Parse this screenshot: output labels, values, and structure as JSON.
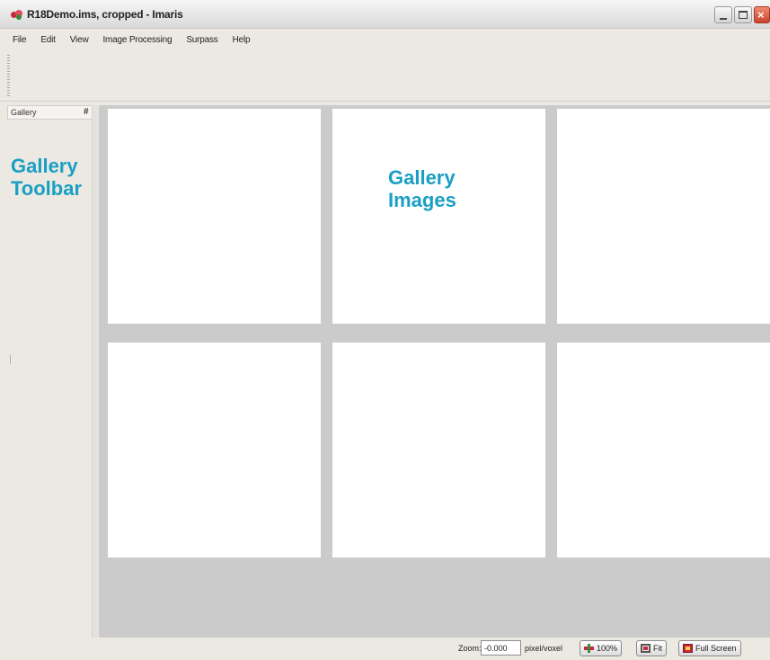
{
  "window": {
    "title": "R18Demo.ims, cropped  - Imaris",
    "controls": {
      "minimize": "_",
      "maximize": "□",
      "close": "×"
    }
  },
  "menu": {
    "items": [
      "File",
      "Edit",
      "View",
      "Image Processing",
      "Surpass",
      "Help"
    ]
  },
  "gallery_panel": {
    "title": "Gallery",
    "pin_glyph": "#"
  },
  "annotations": {
    "toolbar_line1": "Gallery",
    "toolbar_line2": "Toolbar",
    "images_line1": "Gallery",
    "images_line2": "Images",
    "color": "#1a9fc4"
  },
  "gallery": {
    "tile_count": 6,
    "background": "#cbcbcb"
  },
  "statusbar": {
    "zoom_label": "Zoom:",
    "zoom_value": "-0.000",
    "unit_label": "pixel/voxel",
    "btn_100": "100%",
    "btn_fit": "Fit",
    "btn_fullscreen": "Full Screen"
  },
  "icons": {
    "app": "imaris-app-icon",
    "pin": "pin-icon",
    "zoom_100": "zoom-100-icon",
    "zoom_fit": "zoom-fit-icon",
    "fullscreen": "fullscreen-icon"
  }
}
